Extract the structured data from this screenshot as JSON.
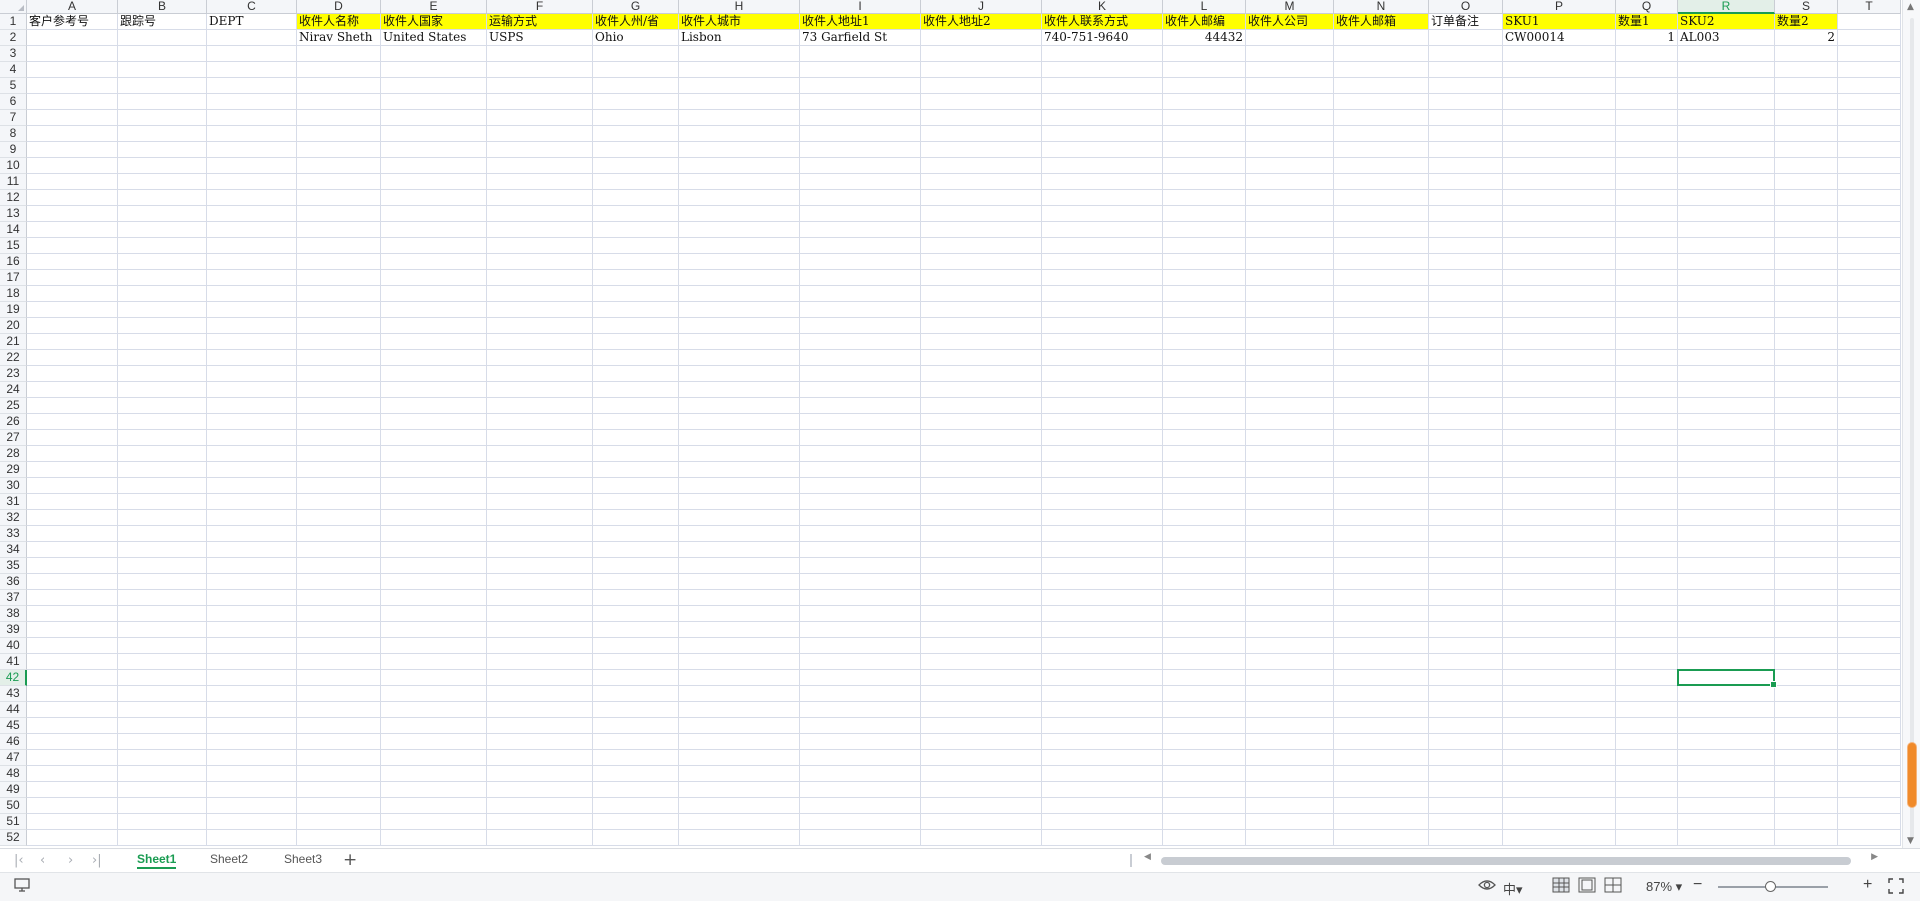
{
  "columns": [
    "A",
    "B",
    "C",
    "D",
    "E",
    "F",
    "G",
    "H",
    "I",
    "J",
    "K",
    "L",
    "M",
    "N",
    "O",
    "P",
    "Q",
    "R",
    "S",
    "T"
  ],
  "active_column": "R",
  "row_count": 52,
  "active_row": 42,
  "header_row": [
    "客户参考号",
    "跟踪号",
    "DEPT",
    "收件人名称",
    "收件人国家",
    "运输方式",
    "收件人州/省",
    "收件人城市",
    "收件人地址1",
    "收件人地址2",
    "收件人联系方式",
    "收件人邮编",
    "收件人公司",
    "收件人邮箱",
    "订单备注",
    "SKU1",
    "数量1",
    "SKU2",
    "数量2",
    ""
  ],
  "highlighted_header_columns": [
    "D",
    "E",
    "F",
    "G",
    "H",
    "I",
    "J",
    "K",
    "L",
    "M",
    "N",
    "P",
    "Q",
    "R",
    "S"
  ],
  "data_rows": [
    [
      "",
      "",
      "",
      "Nirav Sheth",
      "United States",
      "USPS",
      "Ohio",
      "Lisbon",
      "73 Garfield St",
      "",
      "740-751-9640",
      "44432",
      "",
      "",
      "",
      "CW00014",
      "1",
      "AL003",
      "2",
      ""
    ]
  ],
  "numeric_columns": [
    "L",
    "Q",
    "S"
  ],
  "highlight_color": "#ffff00",
  "accent_color": "#1a9c52",
  "sheet_tabs": [
    "Sheet1",
    "Sheet2",
    "Sheet3"
  ],
  "active_sheet": "Sheet1",
  "zoom_label": "87%",
  "zoom_fraction": 0.47,
  "icons": {
    "nav_first": "first-sheet-icon",
    "nav_prev": "prev-sheet-icon",
    "nav_next": "next-sheet-icon",
    "nav_last": "last-sheet-icon",
    "add_sheet": "plus-icon",
    "eye": "eye-protection-icon",
    "input_method": "input-method-icon",
    "normal_view": "normal-view-icon",
    "page_layout": "page-layout-icon",
    "page_break": "page-break-icon",
    "zoom_out": "minus-icon",
    "zoom_in": "plus-icon",
    "fullscreen": "fullscreen-icon",
    "monitor": "monitor-icon"
  }
}
